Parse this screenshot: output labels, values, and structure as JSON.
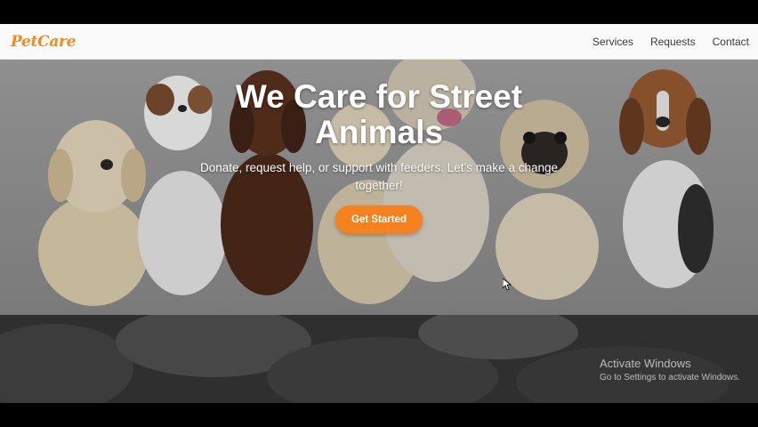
{
  "navbar": {
    "logo": "PetCare",
    "links": [
      "Services",
      "Requests",
      "Contact"
    ]
  },
  "hero": {
    "title": "We Care for Street Animals",
    "subtitle": "Donate, request help, or support with feeders. Let’s make a change together!",
    "cta_label": "Get Started"
  },
  "watermark": {
    "title": "Activate Windows",
    "subtitle": "Go to Settings to activate Windows."
  },
  "colors": {
    "brand": "#f38a1f",
    "cta": "#f5821f"
  },
  "icons": [
    "cursor-icon"
  ]
}
